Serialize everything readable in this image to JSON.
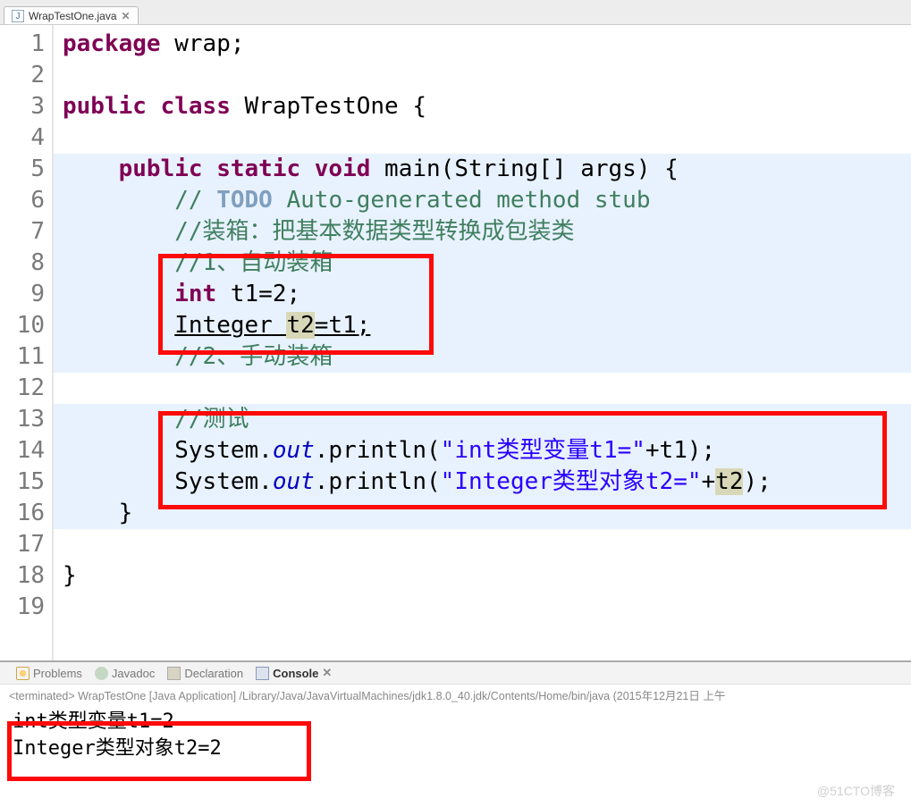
{
  "tab": {
    "filename": "WrapTestOne.java",
    "icon_letter": "J"
  },
  "gutter": [
    "1",
    "2",
    "3",
    "4",
    "5",
    "6",
    "7",
    "8",
    "9",
    "10",
    "11",
    "12",
    "13",
    "14",
    "15",
    "16",
    "17",
    "18",
    "19"
  ],
  "highlighted_lines": [
    5,
    6,
    7,
    8,
    9,
    10,
    11,
    13,
    14,
    15,
    16
  ],
  "code": {
    "l1": {
      "kw1": "package",
      "rest": " wrap;"
    },
    "l3": {
      "kw1": "public",
      "kw2": "class",
      "name": " WrapTestOne {"
    },
    "l5": {
      "indent": "    ",
      "kw1": "public",
      "kw2": "static",
      "kw3": "void",
      "rest": " main(String[] args) {"
    },
    "l6": {
      "indent": "        ",
      "cm_prefix": "// ",
      "todo": "TODO",
      "cm_rest": " Auto-generated method stub"
    },
    "l7": {
      "indent": "        ",
      "cm": "//装箱：把基本数据类型转换成包装类"
    },
    "l8": {
      "indent": "        ",
      "cm": "//1、自动装箱"
    },
    "l9": {
      "indent": "        ",
      "kw": "int",
      "rest": " t1=2;"
    },
    "l10": {
      "indent": "        ",
      "type": "Integer ",
      "var": "t2",
      "rest": "=t1;"
    },
    "l11": {
      "indent": "        ",
      "cm": "//2、手动装箱"
    },
    "l13": {
      "indent": "        ",
      "cm": "//测试"
    },
    "l14": {
      "indent": "        ",
      "pre": "System.",
      "out": "out",
      "mid": ".println(",
      "str": "\"int类型变量t1=\"",
      "post": "+t1);"
    },
    "l15": {
      "indent": "        ",
      "pre": "System.",
      "out": "out",
      "mid": ".println(",
      "str": "\"Integer类型对象t2=\"",
      "post_a": "+",
      "var": "t2",
      "post_b": ");"
    },
    "l16": {
      "text": "    }"
    },
    "l18": {
      "text": "}"
    }
  },
  "panel": {
    "problems": "Problems",
    "javadoc": "Javadoc",
    "declaration": "Declaration",
    "console": "Console"
  },
  "terminated": "<terminated> WrapTestOne [Java Application] /Library/Java/JavaVirtualMachines/jdk1.8.0_40.jdk/Contents/Home/bin/java (2015年12月21日 上午",
  "console_out": {
    "line1": "int类型变量t1=2",
    "line2": "Integer类型对象t2=2"
  },
  "watermark": "@51CTO博客"
}
